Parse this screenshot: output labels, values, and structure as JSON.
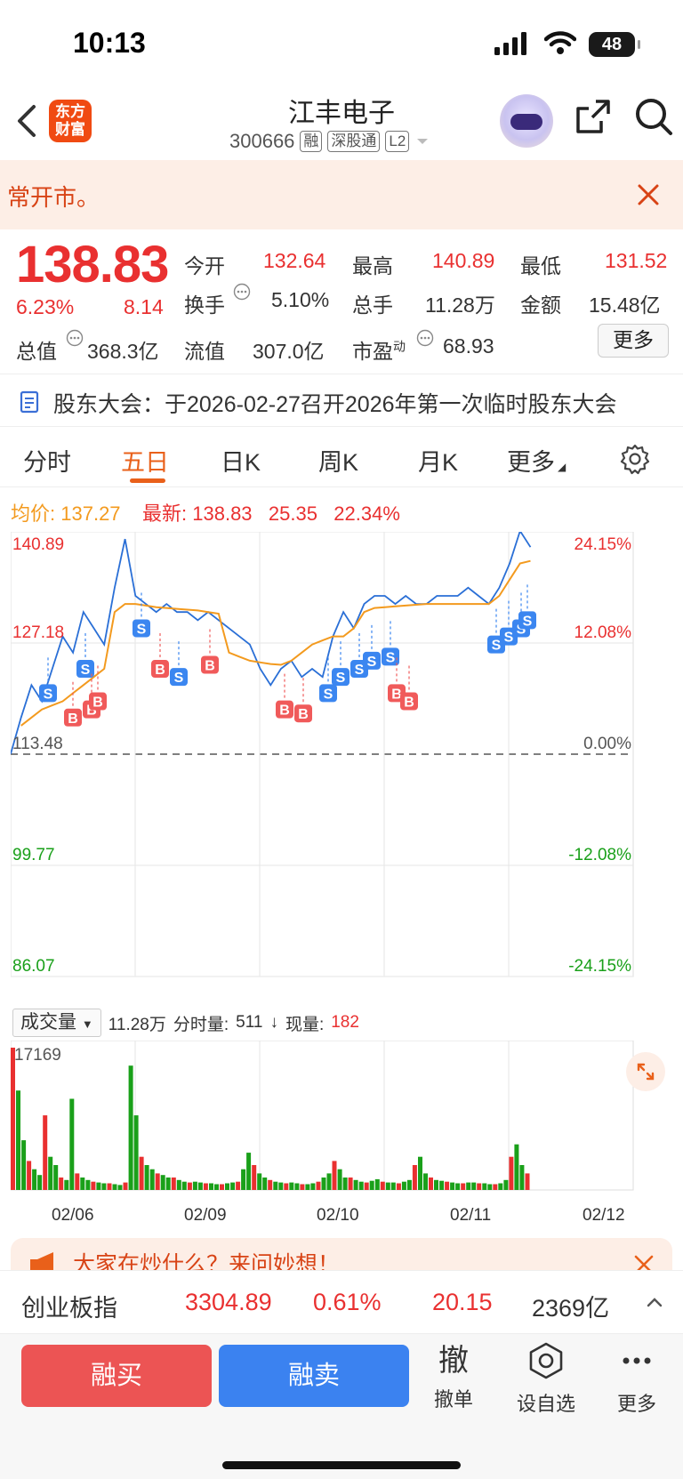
{
  "status_bar": {
    "time": "10:13",
    "battery": "48"
  },
  "header": {
    "back_icon": "chevron-left-icon",
    "app_logo": "东方财富",
    "stock_name": "江丰电子",
    "stock_code": "300666",
    "tags": [
      "融",
      "深股通",
      "L2"
    ],
    "share_icon": "share-icon",
    "search_icon": "search-icon"
  },
  "notice": {
    "text": "常开市。"
  },
  "quote": {
    "price": "138.83",
    "change_pct": "6.23%",
    "change_amt": "8.14",
    "fields": [
      {
        "label": "今开",
        "value": "132.64",
        "color": "red"
      },
      {
        "label": "最高",
        "value": "140.89",
        "color": "red"
      },
      {
        "label": "最低",
        "value": "131.52",
        "color": "red"
      },
      {
        "label": "换手",
        "value": "5.10%",
        "color": "grey"
      },
      {
        "label": "总手",
        "value": "11.28万",
        "color": "grey"
      },
      {
        "label": "金额",
        "value": "15.48亿",
        "color": "grey"
      },
      {
        "label": "总值",
        "value": "368.3亿",
        "color": "grey"
      },
      {
        "label": "流值",
        "value": "307.0亿",
        "color": "grey"
      },
      {
        "label": "市盈",
        "label_sup": "动",
        "value": "68.93",
        "color": "grey"
      }
    ],
    "more_button": "更多"
  },
  "announcement": {
    "text": "股东大会：于2026-02-27召开2026年第一次临时股东大会"
  },
  "tabs": [
    {
      "label": "分时"
    },
    {
      "label": "五日"
    },
    {
      "label": "日K"
    },
    {
      "label": "周K"
    },
    {
      "label": "月K"
    },
    {
      "label": "更多"
    }
  ],
  "active_tab": "五日",
  "info_line": {
    "avg_label": "均价:",
    "avg_value": "137.27",
    "latest_label": "最新:",
    "latest_value": "138.83",
    "change_amt": "25.35",
    "change_pct": "22.34%"
  },
  "chart_data": {
    "type": "line",
    "price_axis_left": [
      "140.89",
      "127.18",
      "113.48",
      "99.77",
      "86.07"
    ],
    "price_axis_right": [
      "24.15%",
      "12.08%",
      "0.00%",
      "-12.08%",
      "-24.15%"
    ],
    "ylim": [
      86.07,
      140.89
    ],
    "baseline": 113.48,
    "days": [
      "02/06",
      "02/09",
      "02/10",
      "02/11",
      "02/12"
    ],
    "series": [
      {
        "name": "最新",
        "color": "#2a6fd6",
        "values": [
          113.5,
          118,
          122,
          120,
          124,
          128,
          126,
          131,
          129,
          127,
          134,
          140,
          133,
          132,
          131,
          132,
          131,
          131,
          130,
          131,
          130,
          129,
          128,
          127,
          124,
          122,
          124,
          125,
          123,
          124,
          123,
          128,
          131,
          129,
          132,
          133,
          133,
          132,
          133,
          132,
          132,
          133,
          133,
          133,
          134,
          133,
          132,
          134,
          137,
          141,
          139
        ]
      },
      {
        "name": "均价",
        "color": "#f39a1e",
        "values": [
          null,
          117,
          118,
          119,
          119.5,
          120,
          121,
          122,
          123,
          124,
          131,
          132,
          132,
          131.8,
          131.6,
          131.5,
          131.4,
          131.3,
          131.2,
          131,
          130.8,
          126,
          125.5,
          125,
          124.8,
          124.6,
          124.5,
          125,
          126,
          127,
          127.5,
          128,
          128,
          129,
          131,
          131.5,
          131.6,
          131.7,
          131.8,
          131.9,
          132,
          132,
          132,
          132,
          132,
          132,
          132,
          133,
          135,
          137,
          137.3
        ]
      }
    ],
    "trade_markers": [
      "S",
      "B"
    ]
  },
  "volume": {
    "select_label": "成交量",
    "total": "11.28万",
    "tick_label": "分时量:",
    "tick_value": "511",
    "tick_arrow": "↓",
    "now_label": "现量:",
    "now_value": "182",
    "max_label": "17169",
    "bars": [
      17169,
      12000,
      6000,
      3500,
      2500,
      1800,
      9000,
      4000,
      3000,
      1500,
      1200,
      11000,
      2000,
      1500,
      1200,
      1000,
      900,
      800,
      800,
      700,
      600,
      900,
      15000,
      9000,
      4000,
      3000,
      2500,
      2000,
      1800,
      1500,
      1500,
      1200,
      1000,
      900,
      1000,
      900,
      800,
      800,
      700,
      700,
      800,
      900,
      1000,
      2500,
      4500,
      3000,
      2000,
      1500,
      1200,
      1000,
      900,
      800,
      900,
      800,
      700,
      700,
      800,
      1000,
      1500,
      2000,
      3500,
      2500,
      1500,
      1500,
      1200,
      1000,
      900,
      1100,
      1300,
      1000,
      900,
      900,
      800,
      1000,
      1200,
      3000,
      4000,
      2000,
      1500,
      1200,
      1100,
      1000,
      900,
      800,
      800,
      900,
      900,
      800,
      800,
      700,
      700,
      800,
      1200,
      4000,
      5500,
      3000,
      2000
    ]
  },
  "promo": {
    "text": "大家在炒什么？来问妙想！"
  },
  "index_bar": {
    "name": "创业板指",
    "value": "3304.89",
    "pct": "0.61%",
    "amt": "20.15",
    "turnover": "2369亿"
  },
  "bottom_bar": {
    "buy": "融买",
    "sell": "融卖",
    "actions": [
      {
        "icon": "撤",
        "label": "撤单"
      },
      {
        "icon": "target-icon",
        "label": "设自选"
      },
      {
        "icon": "more-dots-icon",
        "label": "更多"
      }
    ]
  }
}
